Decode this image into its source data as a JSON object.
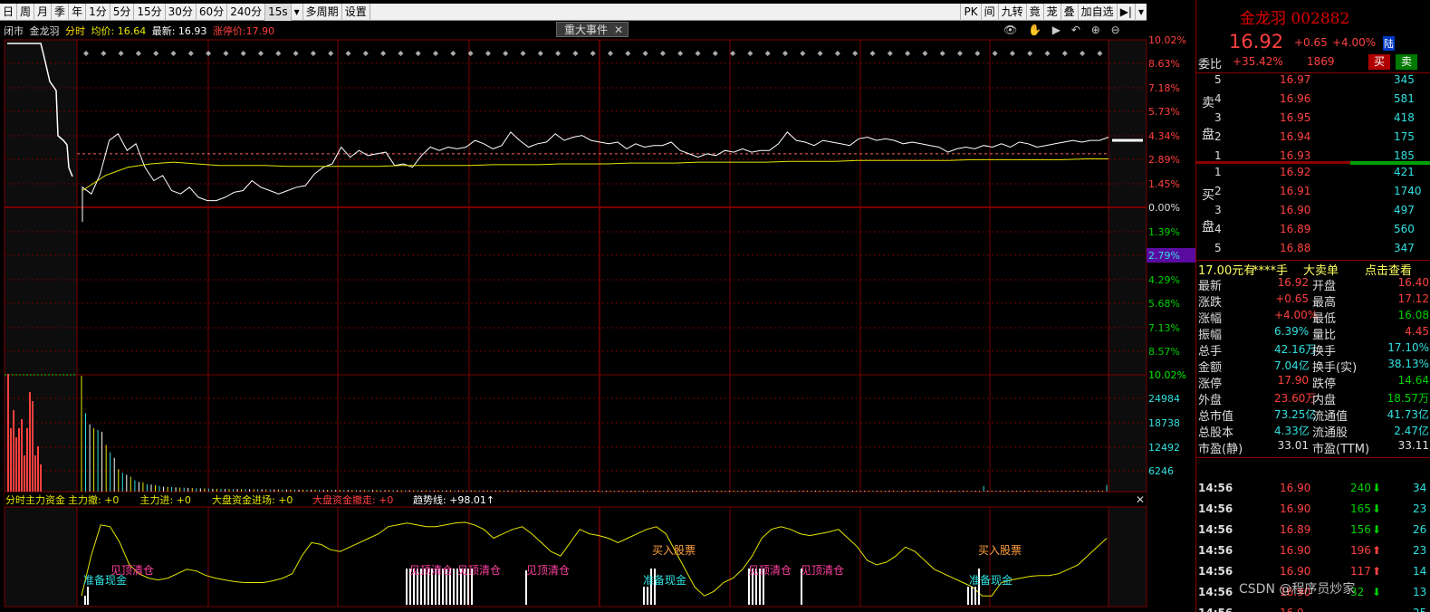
{
  "toolbar": {
    "items": [
      "日",
      "周",
      "月",
      "季",
      "年",
      "1分",
      "5分",
      "15分",
      "30分",
      "60分",
      "240分",
      "15s",
      "▾",
      "多周期",
      "设置"
    ],
    "right": [
      "PK",
      "间",
      "九转",
      "竟",
      "茏",
      "叠",
      "加自选",
      "▶|",
      "▾"
    ]
  },
  "info": {
    "status": "闭市",
    "name": "金龙羽",
    "mode": "分时",
    "avg_label": "均价: 16.64",
    "last_label": "最新: 16.93",
    "limit_label": "涨停价:17.90"
  },
  "event_button": "重大事件",
  "controls": "👁 ✋ ▶ ↶ ⊕ ⊖",
  "chart_data": [
    {
      "type": "line",
      "title": "",
      "y_right_ticks": [
        "10.02%",
        "8.63%",
        "7.18%",
        "5.73%",
        "4.34%",
        "2.89%",
        "1.45%",
        "0.00%",
        "1.39%",
        "2.79%",
        "4.29%",
        "5.68%",
        "7.13%",
        "8.57%",
        "10.02%"
      ],
      "prev_close_pct": 0.0,
      "highlight_tick": "2.79%",
      "series": [
        {
          "name": "",
          "values": [
            1.2,
            0.8,
            2.0,
            4.0,
            4.4,
            3.4,
            3.8,
            2.4,
            1.6,
            1.9,
            1.0,
            0.8,
            1.2,
            0.6,
            0.4,
            0.4,
            0.6,
            0.9,
            1.0,
            1.6,
            1.2,
            1.0,
            0.8,
            1.0,
            1.2,
            1.3,
            2.0,
            2.4,
            2.6,
            3.6,
            3.0,
            3.4,
            3.1,
            3.2,
            3.3,
            2.5,
            2.6,
            2.4,
            3.1,
            3.6,
            3.4,
            3.6,
            3.5,
            3.6,
            4.0,
            3.8,
            3.5,
            3.7,
            4.5,
            4.0,
            3.6,
            3.8,
            3.9,
            4.4,
            4.0,
            4.2,
            4.3,
            4.0,
            3.9,
            3.8,
            3.9,
            3.5,
            3.8,
            3.6,
            3.7,
            3.7,
            3.9,
            3.4,
            3.2,
            3.0,
            3.2,
            3.1,
            3.4,
            3.3,
            3.5,
            3.3,
            3.4,
            3.4,
            3.8,
            4.5,
            4.0,
            3.9,
            3.7,
            4.0,
            3.9,
            3.8,
            3.7,
            4.1,
            4.2,
            4.0,
            4.1,
            4.0,
            3.8,
            3.9,
            3.8,
            3.7,
            3.6,
            3.3,
            3.5,
            3.6,
            3.5,
            3.7,
            3.6,
            3.8,
            3.6,
            3.9,
            3.8,
            3.6,
            3.7,
            3.8,
            3.9,
            4.0,
            3.9,
            4.0,
            4.0,
            4.2
          ]
        },
        {
          "name": "",
          "values": [
            1.0,
            1.9,
            2.4,
            2.6,
            2.7,
            2.6,
            2.5,
            2.5,
            2.5,
            2.45,
            2.45,
            2.45,
            2.45,
            2.45,
            2.5,
            2.5,
            2.5,
            2.5,
            2.55,
            2.55,
            2.55,
            2.6,
            2.6,
            2.6,
            2.65,
            2.65,
            2.65,
            2.7,
            2.7,
            2.7,
            2.7,
            2.75,
            2.75,
            2.75,
            2.8,
            2.8,
            2.8,
            2.8,
            2.8,
            2.85,
            2.85,
            2.85,
            2.85,
            2.85,
            2.9,
            2.9
          ]
        }
      ]
    },
    {
      "type": "bar",
      "title": "",
      "y_right_ticks": [
        "10.02%",
        "24984",
        "18738",
        "12492",
        "6246"
      ],
      "values": [
        31000,
        21000,
        18000,
        17000,
        16500,
        16000,
        12500,
        10500,
        9000,
        6000,
        5000,
        4500,
        4000,
        3000,
        2600,
        2500,
        2000,
        1900,
        1700,
        1500,
        1300,
        1250,
        1200,
        1150,
        1100,
        1050,
        1000,
        950,
        900,
        860,
        850,
        800,
        760,
        740,
        720,
        700,
        700,
        690,
        680,
        660,
        650,
        640,
        630,
        620,
        600,
        600,
        580,
        570,
        560,
        550,
        540,
        530,
        520,
        520,
        510,
        500,
        500,
        490,
        480,
        470,
        460,
        460,
        450,
        450,
        440,
        430,
        430,
        420,
        420,
        410,
        410,
        400,
        400,
        390,
        390,
        380,
        380,
        380,
        370,
        370,
        360,
        360,
        360,
        350,
        350,
        340,
        340,
        340,
        330,
        330,
        330,
        320,
        320,
        320,
        310,
        310,
        310,
        300,
        300,
        300,
        290,
        290,
        290,
        280,
        280,
        280,
        280,
        270,
        270,
        270,
        260,
        260,
        260,
        260,
        250,
        250,
        250,
        250,
        240,
        240,
        240,
        240,
        230,
        230,
        230,
        230,
        220,
        220,
        220,
        220,
        210,
        210,
        210,
        210,
        200,
        200,
        200,
        200,
        200,
        190,
        190,
        190,
        190,
        190,
        180,
        180,
        180,
        180,
        180,
        170,
        170,
        170,
        170,
        170,
        160,
        160,
        160,
        160,
        160,
        150,
        150,
        150,
        150,
        150,
        150,
        140,
        140,
        140,
        140,
        140,
        140,
        130,
        130,
        130,
        130,
        130,
        130,
        120,
        120,
        120,
        120,
        120,
        120,
        110,
        110,
        110,
        110,
        110,
        110,
        100,
        100,
        100,
        100,
        100,
        100,
        95,
        95,
        95,
        95,
        95,
        90,
        90,
        90,
        90,
        90,
        85,
        85,
        85,
        85,
        85,
        80,
        80,
        80,
        80,
        80,
        80,
        80,
        80,
        80,
        80,
        1500,
        80,
        80,
        80,
        80,
        80,
        80,
        80,
        80,
        80,
        80,
        80,
        80,
        80,
        80,
        80,
        80,
        80,
        80,
        80,
        80,
        80,
        80,
        80,
        80,
        80,
        80,
        80,
        80,
        80,
        1800
      ]
    },
    {
      "type": "line",
      "title": "",
      "legend": {
        "main": "分时主力资金",
        "retreat": "主力撤: +0",
        "enter": "主力进: +0",
        "big_enter": "大盘资金进场: +0",
        "big_exit": "大盘资金撤走: +0",
        "trend": "趋势线: +98.01↑"
      },
      "values": [
        10,
        55,
        90,
        88,
        70,
        45,
        35,
        30,
        28,
        30,
        35,
        40,
        38,
        33,
        30,
        28,
        26,
        25,
        25,
        25,
        27,
        30,
        35,
        55,
        70,
        68,
        62,
        60,
        65,
        70,
        75,
        80,
        88,
        90,
        92,
        90,
        88,
        88,
        90,
        92,
        93,
        90,
        85,
        75,
        80,
        85,
        88,
        80,
        70,
        60,
        55,
        70,
        85,
        80,
        78,
        75,
        70,
        75,
        80,
        85,
        88,
        80,
        60,
        40,
        20,
        10,
        15,
        25,
        30,
        40,
        55,
        75,
        85,
        88,
        85,
        80,
        78,
        80,
        82,
        85,
        75,
        65,
        50,
        45,
        48,
        55,
        65,
        60,
        50,
        40,
        35,
        30,
        25,
        20,
        10,
        10,
        25,
        28,
        30,
        32,
        33,
        33,
        35,
        40,
        45,
        55,
        65,
        75
      ]
    }
  ],
  "annotations": {
    "labels": [
      "见顶清仓",
      "准备现金",
      "见顶清仓",
      "见顶清仓",
      "见顶清仓",
      "买入股票",
      "准备现金",
      "见顶清仓",
      "见顶清仓",
      "买入股票",
      "准备现金"
    ]
  },
  "side": {
    "title": "金龙羽 002882",
    "price": "16.92",
    "change": "+0.65",
    "pct": "+4.00%",
    "lu": "陆",
    "wb_label": "委比",
    "wb_pct": "+35.42%",
    "wb_val": "1869",
    "buy_btn": "买",
    "sell_btn": "卖",
    "sell_label": [
      "卖",
      "盘"
    ],
    "buy_label": [
      "买",
      "盘"
    ],
    "asks": [
      {
        "n": "5",
        "p": "16.97",
        "v": "345"
      },
      {
        "n": "4",
        "p": "16.96",
        "v": "581"
      },
      {
        "n": "3",
        "p": "16.95",
        "v": "418"
      },
      {
        "n": "2",
        "p": "16.94",
        "v": "175"
      },
      {
        "n": "1",
        "p": "16.93",
        "v": "185"
      }
    ],
    "bids": [
      {
        "n": "1",
        "p": "16.92",
        "v": "421"
      },
      {
        "n": "2",
        "p": "16.91",
        "v": "1740"
      },
      {
        "n": "3",
        "p": "16.90",
        "v": "497"
      },
      {
        "n": "4",
        "p": "16.89",
        "v": "560"
      },
      {
        "n": "5",
        "p": "16.88",
        "v": "347"
      }
    ],
    "big": {
      "a": "17.00元有",
      "b": "****手",
      "c": "大卖单",
      "d": "点击查看"
    },
    "stats": [
      {
        "l1": "最新",
        "v1": "16.92",
        "c1": "#ff4040",
        "l2": "开盘",
        "v2": "16.40",
        "c2": "#ff4040"
      },
      {
        "l1": "涨跌",
        "v1": "+0.65",
        "c1": "#ff4040",
        "l2": "最高",
        "v2": "17.12",
        "c2": "#ff4040"
      },
      {
        "l1": "涨幅",
        "v1": "+4.00%",
        "c1": "#ff4040",
        "l2": "最低",
        "v2": "16.08",
        "c2": "#00d000"
      },
      {
        "l1": "振幅",
        "v1": "6.39%",
        "c1": "#30e0e0",
        "l2": "量比",
        "v2": "4.45",
        "c2": "#ff4040"
      },
      {
        "l1": "总手",
        "v1": "42.16万",
        "c1": "#30e0e0",
        "l2": "换手",
        "v2": "17.10%",
        "c2": "#30e0e0"
      },
      {
        "l1": "金额",
        "v1": "7.04亿",
        "c1": "#30e0e0",
        "l2": "换手(实)",
        "v2": "38.13%",
        "c2": "#30e0e0"
      },
      {
        "l1": "涨停",
        "v1": "17.90",
        "c1": "#ff4040",
        "l2": "跌停",
        "v2": "14.64",
        "c2": "#00d000"
      },
      {
        "l1": "外盘",
        "v1": "23.60万",
        "c1": "#ff4040",
        "l2": "内盘",
        "v2": "18.57万",
        "c2": "#00d000"
      },
      {
        "l1": "总市值",
        "v1": "73.25亿",
        "c1": "#30e0e0",
        "l2": "流通值",
        "v2": "41.73亿",
        "c2": "#30e0e0"
      },
      {
        "l1": "总股本",
        "v1": "4.33亿",
        "c1": "#30e0e0",
        "l2": "流通股",
        "v2": "2.47亿",
        "c2": "#30e0e0"
      },
      {
        "l1": "市盈(静)",
        "v1": "33.01",
        "c1": "#e0e0e0",
        "l2": "市盈(TTM)",
        "v2": "33.11",
        "c2": "#e0e0e0"
      }
    ],
    "ticks": [
      {
        "t": "14:56",
        "p": "16.90",
        "v": "240",
        "d": "down",
        "n": "34"
      },
      {
        "t": "14:56",
        "p": "16.90",
        "v": "165",
        "d": "down",
        "n": "23"
      },
      {
        "t": "14:56",
        "p": "16.89",
        "v": "156",
        "d": "down",
        "n": "26"
      },
      {
        "t": "14:56",
        "p": "16.90",
        "v": "196",
        "d": "up",
        "n": "23"
      },
      {
        "t": "14:56",
        "p": "16.90",
        "v": "117",
        "d": "up",
        "n": "14"
      },
      {
        "t": "14:56",
        "p": "16.90",
        "v": "32",
        "d": "down",
        "n": "13"
      },
      {
        "t": "14:56",
        "p": "16.9",
        "v": "",
        "d": "",
        "n": "25"
      }
    ]
  },
  "watermark": "CSDN @程序员炒家",
  "colors": {
    "up": "#ff4040",
    "down": "#00d000",
    "grid": "#7a0000",
    "price_line": "#ffffff",
    "avg_line": "#e6e600",
    "cyan": "#30e0e0"
  }
}
